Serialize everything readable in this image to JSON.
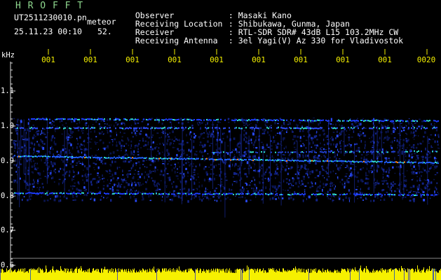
{
  "header": {
    "brand": "H R O F F T",
    "filename": "UT2511230010.pn",
    "tag": "meteor",
    "datetime": "25.11.23 00:10",
    "count": "52."
  },
  "meta": [
    {
      "label": "Observer",
      "value": ": Masaki Kano"
    },
    {
      "label": "Receiving Location",
      "value": ": Shibukawa, Gunma, Japan"
    },
    {
      "label": "Receiver",
      "value": ": RTL-SDR SDR# 43dB L15 103.2MHz CW"
    },
    {
      "label": "Receiving Antenna",
      "value": ": 3el Yagi(V) Az 330 for Vladivostok"
    }
  ],
  "axis": {
    "unit": "kHz",
    "y_ticks": [
      "1.1",
      "1.0",
      "0.9",
      "0.8",
      "0.7",
      "0.6"
    ],
    "x_ticks": [
      "001",
      "001",
      "001",
      "001",
      "001",
      "001",
      "001",
      "001",
      "001",
      "0020"
    ]
  },
  "colors": {
    "text_green": "#8fd88f",
    "text_white": "#ffffff",
    "text_yellow": "#f4f000",
    "axis_white": "#dddddd",
    "signal_blue": "#1c3cff",
    "signal_cyan": "#30e0d0",
    "signal_orange": "#ff8a20",
    "footer_yellow": "#f6f000"
  }
}
